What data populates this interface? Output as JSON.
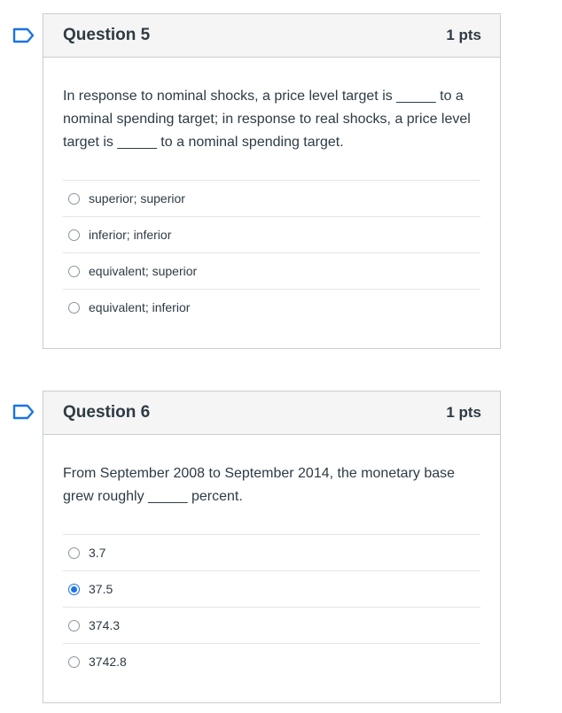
{
  "questions": [
    {
      "title": "Question 5",
      "points": "1 pts",
      "text_parts": [
        "In response to nominal shocks, a price level target is ",
        "_____",
        " to a nominal spending target; in response to real shocks, a price level target is ",
        "_____",
        " to a nominal spending target."
      ],
      "answers": [
        {
          "label": "superior; superior",
          "selected": false
        },
        {
          "label": "inferior; inferior",
          "selected": false
        },
        {
          "label": "equivalent; superior",
          "selected": false
        },
        {
          "label": "equivalent; inferior",
          "selected": false
        }
      ]
    },
    {
      "title": "Question 6",
      "points": "1 pts",
      "text_parts": [
        "From September 2008 to September 2014, the monetary base grew roughly ",
        "_____",
        " percent."
      ],
      "answers": [
        {
          "label": "3.7",
          "selected": false
        },
        {
          "label": "37.5",
          "selected": true
        },
        {
          "label": "374.3",
          "selected": false
        },
        {
          "label": "3742.8",
          "selected": false
        }
      ]
    }
  ],
  "colors": {
    "flag": "#1a73e8",
    "selected_radio": "#1a73e8"
  },
  "icons": {
    "flag": "flag-icon"
  }
}
